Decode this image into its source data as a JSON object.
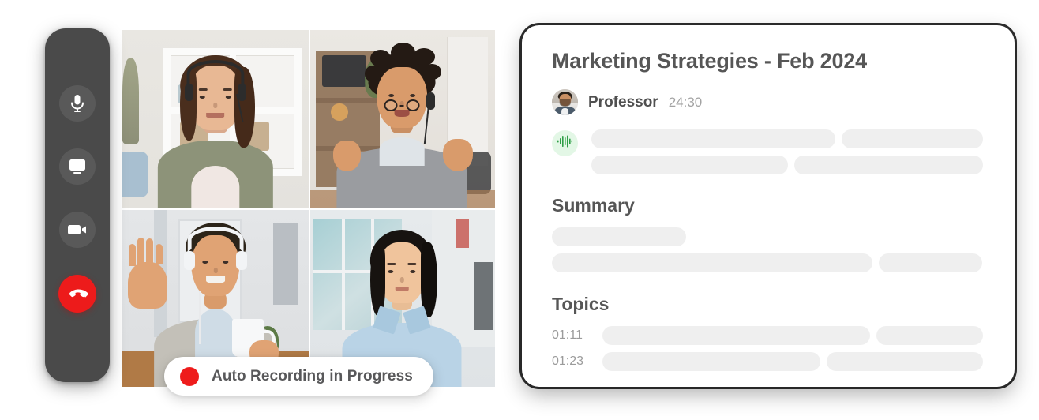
{
  "call": {
    "toolbar": {
      "buttons": [
        {
          "name": "microphone-button",
          "icon": "microphone-icon",
          "label": "Microphone"
        },
        {
          "name": "share-screen-button",
          "icon": "monitor-icon",
          "label": "Share screen"
        },
        {
          "name": "camera-button",
          "icon": "video-camera-icon",
          "label": "Camera"
        },
        {
          "name": "end-call-button",
          "icon": "phone-hangup-icon",
          "label": "End call"
        }
      ]
    },
    "recording": {
      "label": "Auto Recording in Progress",
      "dot_color": "#ee1c1c"
    },
    "participants": [
      {
        "position": "top-left",
        "description": "Woman with headset in front of white shelves"
      },
      {
        "position": "top-right",
        "description": "Man with glasses and headset gesturing with both hands"
      },
      {
        "position": "bottom-left",
        "description": "Man with headphones waving, holding a white mug"
      },
      {
        "position": "bottom-right",
        "description": "Woman in light blue shirt by office windows"
      }
    ]
  },
  "notes": {
    "title": "Marketing Strategies - Feb 2024",
    "speaker": {
      "name": "Professor",
      "timestamp": "24:30",
      "avatar": "professor-avatar"
    },
    "transcript": {
      "waveform_icon": "audio-waveform-icon",
      "waveform_color": "#2f9e47",
      "waveform_bg": "#e3f7e6",
      "skeleton_rows": [
        [
          62,
          36
        ],
        [
          50,
          48
        ]
      ]
    },
    "summary": {
      "heading": "Summary",
      "skeleton_rows": [
        [
          31
        ],
        [
          74,
          24
        ]
      ]
    },
    "topics": {
      "heading": "Topics",
      "rows": [
        {
          "time": "01:11",
          "bars": [
            70,
            28
          ]
        },
        {
          "time": "01:23",
          "bars": [
            57,
            41
          ]
        }
      ]
    }
  },
  "theme": {
    "toolbar_bg": "#4a4a4a",
    "card_bg": "#ffffff",
    "skeleton": "#efefef",
    "heading_color": "#565656",
    "muted_text": "#9b9b9b",
    "accent_red": "#ed1b1b"
  }
}
